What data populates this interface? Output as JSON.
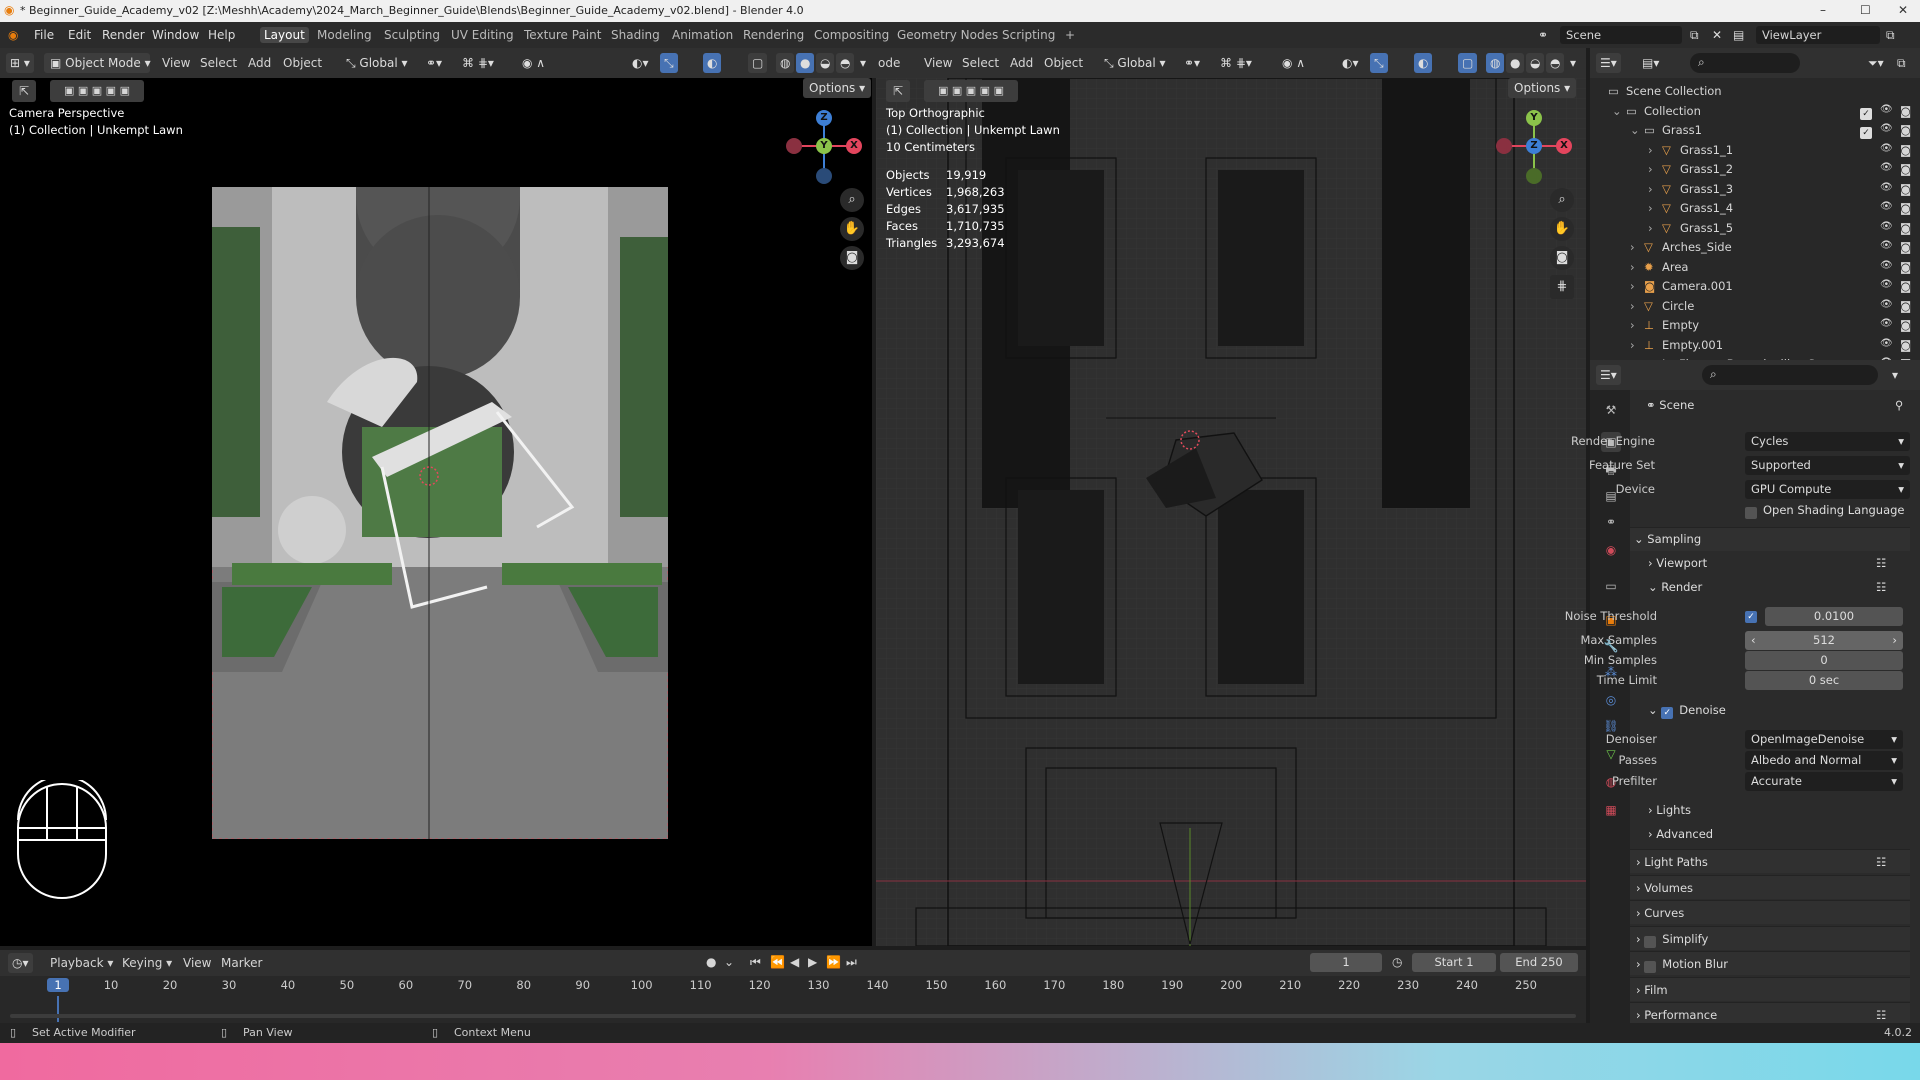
{
  "window": {
    "title": "* Beginner_Guide_Academy_v02 [Z:\\Meshh\\Academy\\2024_March_Beginner_Guide\\Blends\\Beginner_Guide_Academy_v02.blend] - Blender 4.0",
    "controls": [
      "–",
      "☐",
      "✕"
    ]
  },
  "menu": {
    "items": [
      "File",
      "Edit",
      "Render",
      "Window",
      "Help"
    ],
    "workspaces": [
      "Layout",
      "Modeling",
      "Sculpting",
      "UV Editing",
      "Texture Paint",
      "Shading",
      "Animation",
      "Rendering",
      "Compositing",
      "Geometry Nodes",
      "Scripting"
    ],
    "active_workspace": "Layout",
    "add_tab": "+",
    "scene": "Scene",
    "view_layer": "ViewLayer"
  },
  "viewport_left": {
    "mode": "Object Mode",
    "menus": [
      "View",
      "Select",
      "Add",
      "Object"
    ],
    "orientation": "Global",
    "options": "Options",
    "overlay_line1": "Camera Perspective",
    "overlay_line2": "(1) Collection | Unkempt Lawn"
  },
  "viewport_right": {
    "mode_fragment": "ode",
    "menus": [
      "View",
      "Select",
      "Add",
      "Object"
    ],
    "orientation": "Global",
    "options": "Options",
    "overlay_line1": "Top Orthographic",
    "overlay_line2": "(1) Collection | Unkempt Lawn",
    "overlay_line3": "10 Centimeters",
    "stats": [
      {
        "label": "Objects",
        "value": "19,919"
      },
      {
        "label": "Vertices",
        "value": "1,968,263"
      },
      {
        "label": "Edges",
        "value": "3,617,935"
      },
      {
        "label": "Faces",
        "value": "1,710,735"
      },
      {
        "label": "Triangles",
        "value": "3,293,674"
      }
    ]
  },
  "gizmo": {
    "x": "X",
    "y": "Y",
    "z": "Z"
  },
  "outliner": {
    "rows": [
      {
        "label": "Scene Collection",
        "indent": 0
      },
      {
        "label": "Collection",
        "indent": 1
      },
      {
        "label": "Grass1",
        "indent": 2
      },
      {
        "label": "Grass1_1",
        "indent": 3
      },
      {
        "label": "Grass1_2",
        "indent": 3
      },
      {
        "label": "Grass1_3",
        "indent": 3
      },
      {
        "label": "Grass1_4",
        "indent": 3
      },
      {
        "label": "Grass1_5",
        "indent": 3
      },
      {
        "label": "Arches_Side",
        "indent": 2
      },
      {
        "label": "Area",
        "indent": 2
      },
      {
        "label": "Camera.001",
        "indent": 2
      },
      {
        "label": "Circle",
        "indent": 2
      },
      {
        "label": "Empty",
        "indent": 2
      },
      {
        "label": "Empty.001",
        "indent": 2
      },
      {
        "label": "IvyFlowers Bougainvillea Square",
        "indent": 2
      }
    ]
  },
  "properties": {
    "scene_label": "Scene",
    "render_engine_label": "Render Engine",
    "render_engine": "Cycles",
    "feature_set_label": "Feature Set",
    "feature_set": "Supported",
    "device_label": "Device",
    "device": "GPU Compute",
    "osl_label": "Open Shading Language",
    "sampling": "Sampling",
    "viewport": "Viewport",
    "render": "Render",
    "noise_threshold_label": "Noise Threshold",
    "noise_threshold": "0.0100",
    "max_samples_label": "Max Samples",
    "max_samples": "512",
    "min_samples_label": "Min Samples",
    "min_samples": "0",
    "time_limit_label": "Time Limit",
    "time_limit": "0 sec",
    "denoise": "Denoise",
    "denoiser_label": "Denoiser",
    "denoiser": "OpenImageDenoise",
    "passes_label": "Passes",
    "passes": "Albedo and Normal",
    "prefilter_label": "Prefilter",
    "prefilter": "Accurate",
    "lights": "Lights",
    "advanced": "Advanced",
    "panels": [
      "Light Paths",
      "Volumes",
      "Curves",
      "Simplify",
      "Motion Blur",
      "Film",
      "Performance"
    ]
  },
  "timeline": {
    "menus": [
      "Playback",
      "Keying",
      "View",
      "Marker"
    ],
    "current_frame": "1",
    "start_label": "Start",
    "start": "1",
    "end_label": "End",
    "end": "250",
    "ticks": [
      "1",
      "10",
      "20",
      "30",
      "40",
      "50",
      "60",
      "70",
      "80",
      "90",
      "100",
      "110",
      "120",
      "130",
      "140",
      "150",
      "160",
      "170",
      "180",
      "190",
      "200",
      "210",
      "220",
      "230",
      "240",
      "250"
    ]
  },
  "status": {
    "hint1": "Set Active Modifier",
    "hint2": "Pan View",
    "hint3": "Context Menu",
    "version": "4.0.2"
  },
  "colors": {
    "accent": "#4772b3",
    "x_axis": "#e3455d",
    "y_axis": "#8bc34a",
    "z_axis": "#3d7fd6"
  }
}
